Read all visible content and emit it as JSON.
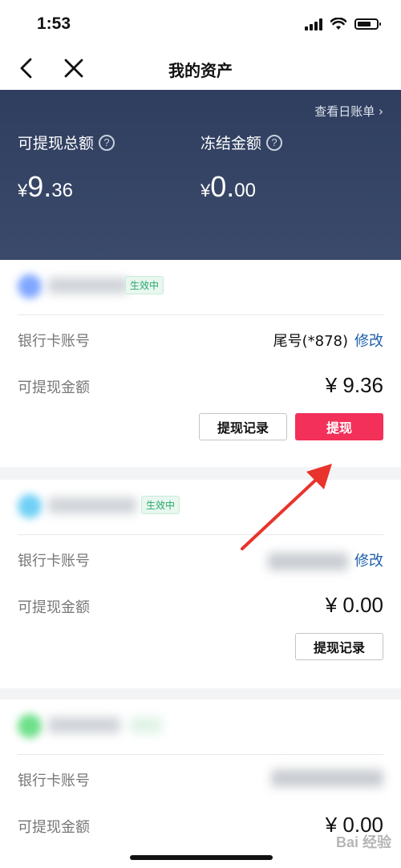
{
  "status_bar": {
    "time": "1:53"
  },
  "nav": {
    "title": "我的资产"
  },
  "summary": {
    "daily_bill_link": "查看日账单",
    "withdrawable_label": "可提现总额",
    "withdrawable_currency": "¥",
    "withdrawable_int": "9.",
    "withdrawable_dec": "36",
    "frozen_label": "冻结金额",
    "frozen_currency": "¥",
    "frozen_int": "0.",
    "frozen_dec": "00"
  },
  "cards": [
    {
      "status_badge": "生效中",
      "bank_label": "银行卡账号",
      "bank_value": "尾号(*878)",
      "edit_label": "修改",
      "amount_label": "可提现金额",
      "amount_value": "¥ 9.36",
      "record_button": "提现记录",
      "withdraw_button": "提现",
      "avatar_color": "#7fa6ff"
    },
    {
      "status_badge": "生效中",
      "bank_label": "银行卡账号",
      "edit_label": "修改",
      "amount_label": "可提现金额",
      "amount_value": "¥ 0.00",
      "record_button": "提现记录",
      "avatar_color": "#6fd0f5"
    },
    {
      "bank_label": "银行卡账号",
      "amount_label": "可提现金额",
      "amount_value": "¥ 0.00",
      "avatar_color": "#6ee08a"
    }
  ],
  "watermark": "Bai 经验",
  "colors": {
    "summary_bg": "#34435f",
    "primary_button": "#f2305a",
    "badge_text": "#2aa86c",
    "link": "#1e5fa8",
    "arrow": "#e8342c"
  }
}
